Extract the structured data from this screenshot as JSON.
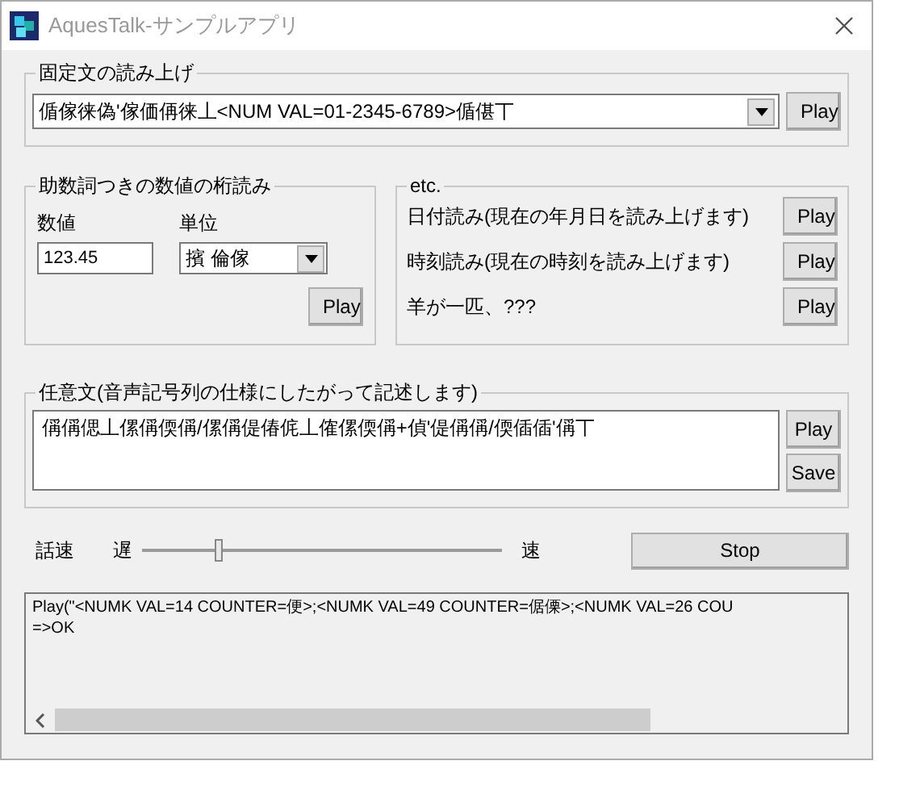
{
  "window": {
    "title": "AquesTalk-サンプルアプリ"
  },
  "fixed_text": {
    "title": "固定文の読み上げ",
    "value": "偱傢徕偽'傢価侢徕丄<NUM VAL=01-2345-6789>偱偡丅",
    "button": "Play"
  },
  "counter_reading": {
    "title": "助数詞つきの数値の桁読み",
    "number_label": "数値",
    "number_value": "123.45",
    "unit_label": "単位",
    "unit_value": "擯 倫傢",
    "button": "Play"
  },
  "etc": {
    "title": "etc.",
    "items": [
      {
        "label": "日付読み(現在の年月日を読み上げます)",
        "button": "Play"
      },
      {
        "label": "時刻読み(現在の時刻を読み上げます)",
        "button": "Play"
      },
      {
        "label": "羊が一匹、???",
        "button": "Play"
      }
    ]
  },
  "free_text": {
    "title": "任意文(音声記号列の仕様にしたがって記述します)",
    "value": "偁偁偲丄傫偁偄偁/傫偁偍偆侂丄傕傫偄偁+偵'偍偁偁/偄偛偛'偁丅",
    "buttons": [
      "Play",
      "Save"
    ]
  },
  "speed": {
    "label": "話速",
    "slow": "遅",
    "fast": "速",
    "level": 0.21,
    "button": "Stop"
  },
  "log": {
    "lines": [
      "Play(\"<NUMK VAL=14 COUNTER=便>;<NUMK VAL=49 COUNTER=倨傈>;<NUMK VAL=26 COU",
      "=>OK"
    ]
  }
}
